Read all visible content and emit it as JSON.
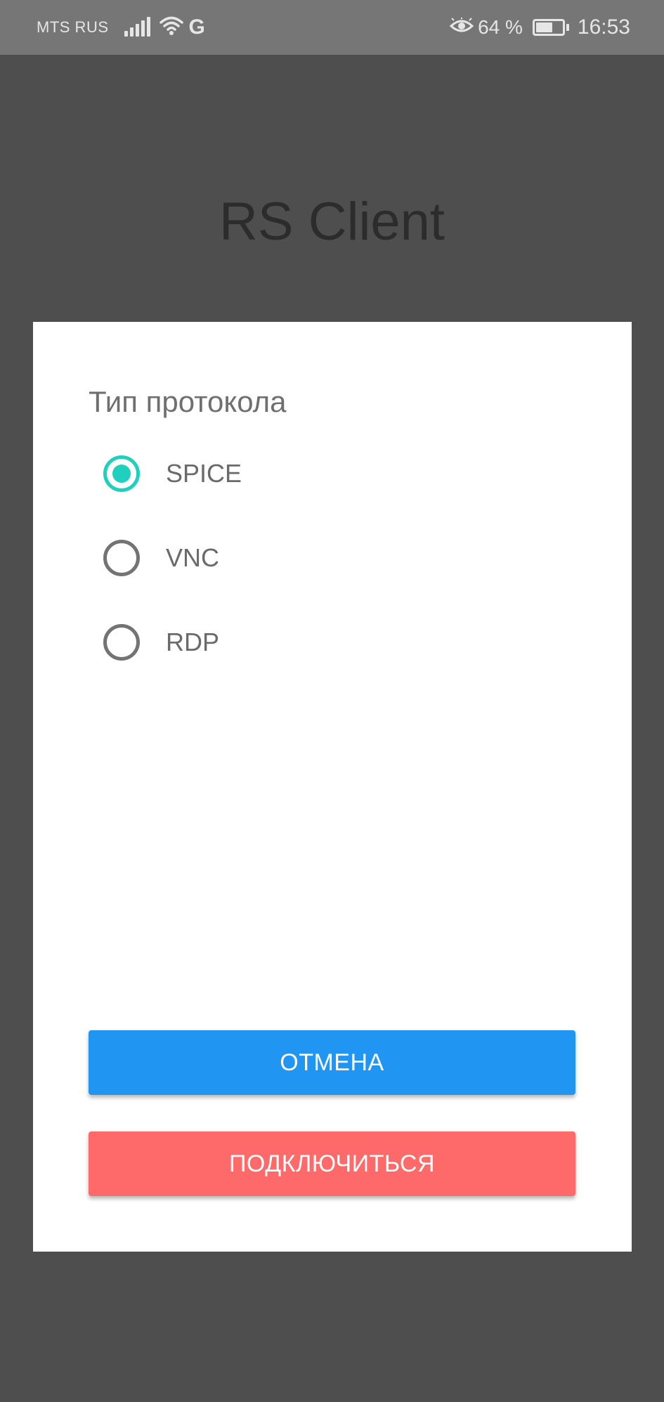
{
  "status_bar": {
    "carrier": "MTS RUS",
    "network_type": "G",
    "battery_percent": "64 %",
    "time": "16:53",
    "icons": [
      "signal-icon",
      "wifi-icon",
      "eye-comfort-icon",
      "battery-icon"
    ]
  },
  "app": {
    "title": "RS Client"
  },
  "dialog": {
    "title": "Тип протокола",
    "options": [
      {
        "label": "SPICE",
        "checked": true
      },
      {
        "label": "VNC",
        "checked": false
      },
      {
        "label": "RDP",
        "checked": false
      }
    ],
    "cancel_label": "ОТМЕНА",
    "connect_label": "ПОДКЛЮЧИТЬСЯ"
  },
  "colors": {
    "accent_radio": "#1ed0bd",
    "cancel_button": "#2195f2",
    "connect_button": "#fe6969",
    "scrim": "#4e4e4e"
  }
}
